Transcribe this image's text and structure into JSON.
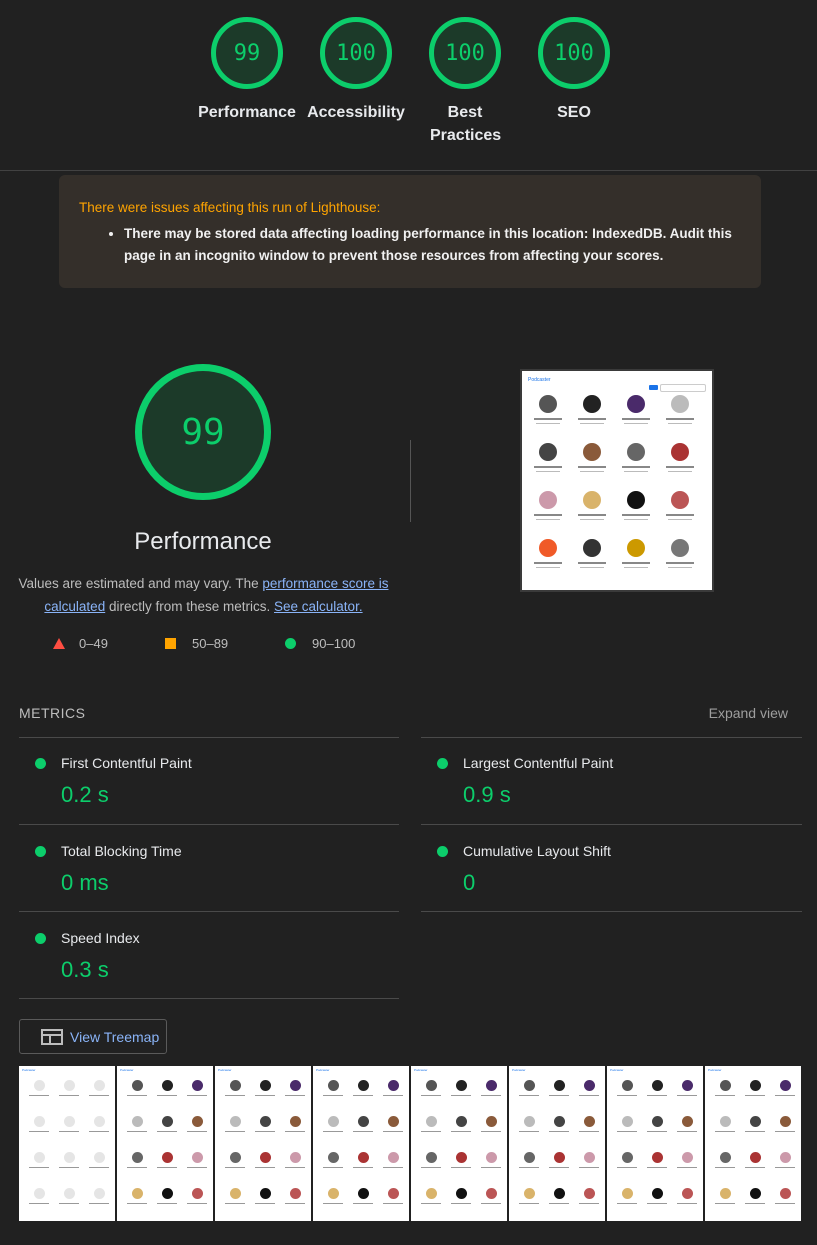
{
  "gauges": [
    {
      "score": "99",
      "label": "Performance"
    },
    {
      "score": "100",
      "label": "Accessibility"
    },
    {
      "score": "100",
      "label": "Best Practices"
    },
    {
      "score": "100",
      "label": "SEO"
    }
  ],
  "warning": {
    "title": "There were issues affecting this run of Lighthouse:",
    "items": [
      "There may be stored data affecting loading performance in this location: IndexedDB. Audit this page in an incognito window to prevent those resources from affecting your scores."
    ]
  },
  "performance": {
    "score": "99",
    "title": "Performance",
    "desc_prefix": "Values are estimated and may vary. The ",
    "desc_link": "performance score is calculated",
    "desc_mid": " directly from these metrics.",
    "calc_link": "See calculator."
  },
  "legend": {
    "fail": "0–49",
    "average": "50–89",
    "pass": "90–100"
  },
  "screenshot": {
    "brand": "Podcaster"
  },
  "metrics": {
    "header": "METRICS",
    "expand": "Expand view",
    "items": [
      {
        "name": "First Contentful Paint",
        "value": "0.2 s"
      },
      {
        "name": "Largest Contentful Paint",
        "value": "0.9 s"
      },
      {
        "name": "Total Blocking Time",
        "value": "0 ms"
      },
      {
        "name": "Cumulative Layout Shift",
        "value": "0"
      },
      {
        "name": "Speed Index",
        "value": "0.3 s"
      }
    ]
  },
  "treemap": {
    "label": "View Treemap"
  },
  "colors": {
    "pass": "#0cce6b",
    "average": "#ffa400",
    "fail": "#ff4e42",
    "link": "#8ab4f8"
  },
  "filmstrip": {
    "frames": 8
  }
}
